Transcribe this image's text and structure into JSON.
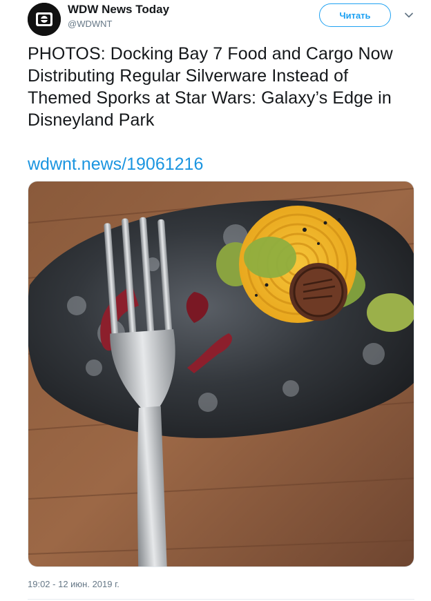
{
  "tweet": {
    "author": {
      "display_name": "WDW News Today",
      "handle": "@WDWNT",
      "avatar_icon": "wdwnt-logo-icon"
    },
    "follow_label": "Читать",
    "menu_icon": "chevron-down-icon",
    "text_lines": [
      "PHOTOS: Docking Bay 7 Food and Cargo Now",
      "Distributing Regular Silverware Instead of",
      "Themed Sporks at Star Wars: Galaxy’s Edge in",
      "Disneyland Park"
    ],
    "link": "wdwnt.news/19061216",
    "timestamp": "19:02 - 12 июн. 2019 г."
  },
  "colors": {
    "accent": "#1da1f2",
    "link": "#1b95e0",
    "text": "#14171a",
    "muted": "#657786",
    "border": "#e6ecf0"
  }
}
